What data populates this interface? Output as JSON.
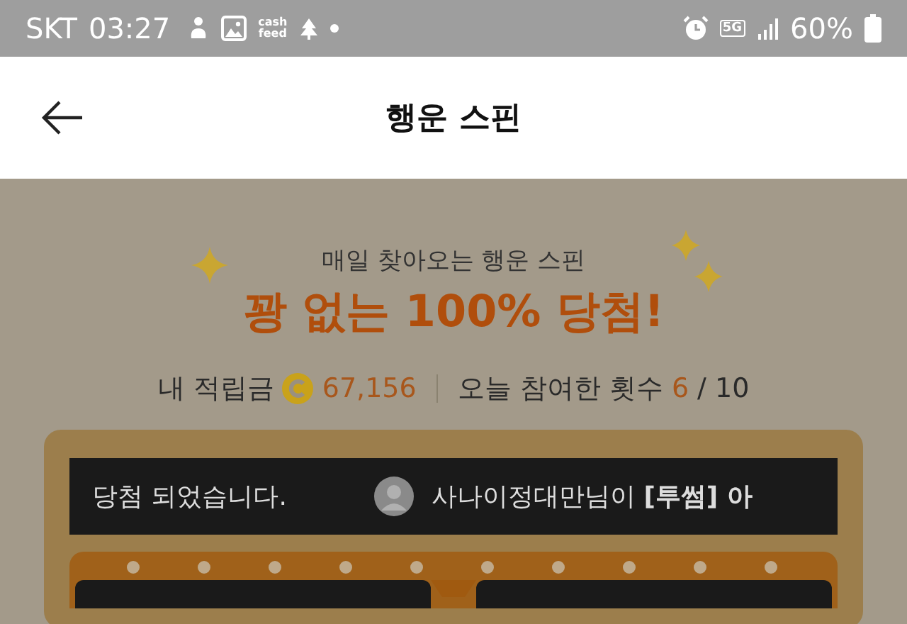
{
  "status_bar": {
    "carrier": "SKT",
    "time": "03:27",
    "app_badge": [
      "cash",
      "feed"
    ],
    "network": "5G",
    "battery": "60%"
  },
  "header": {
    "title": "행운 스핀"
  },
  "promo": {
    "subtitle": "매일 찾아오는 행운 스핀",
    "headline": "꽝 없는 100% 당첨!"
  },
  "summary": {
    "points_label": "내 적립금",
    "points": "67,156",
    "count_label": "오늘 참여한 횟수",
    "count": "6",
    "count_total": "/ 10"
  },
  "ticker": {
    "left": "당첨 되었습니다.",
    "right": "사나이정대만님이 **[투썸] 아**"
  }
}
